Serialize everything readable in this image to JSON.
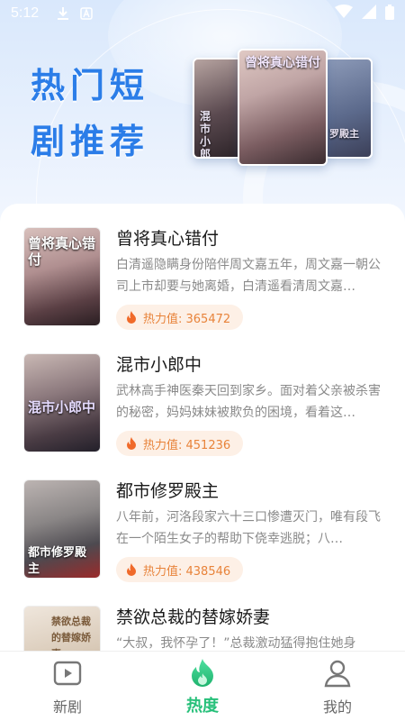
{
  "status_bar": {
    "time": "5:12",
    "left_icons": [
      "download-icon",
      "notification-a-icon"
    ],
    "right_icons": [
      "wifi-icon",
      "signal-icon",
      "battery-icon"
    ]
  },
  "hero": {
    "title_line1": "热门短",
    "title_line2": "剧推荐",
    "posters": [
      {
        "title": "混市小郎中"
      },
      {
        "title": "曾将真心错付"
      },
      {
        "title": "罗殿主"
      }
    ]
  },
  "dramas": [
    {
      "title": "曾将真心错付",
      "cover_text": "曾将真心错付",
      "description": "白清遥隐瞒身份陪伴周文嘉五年，周文嘉一朝公司上市却要与她离婚，白清遥看清周文嘉…",
      "heat_label": "热力值: 365472"
    },
    {
      "title": "混市小郎中",
      "cover_text": "混市小郎中",
      "description": "武林高手神医秦天回到家乡。面对着父亲被杀害的秘密，妈妈妹妹被欺负的困境，看着这…",
      "heat_label": "热力值: 451236"
    },
    {
      "title": "都市修罗殿主",
      "cover_text": "都市修罗殿主",
      "description": "八年前，河洛段家六十三口惨遭灭门，唯有段飞在一个陌生女子的帮助下侥幸逃脱；八…",
      "heat_label": "热力值: 438546"
    },
    {
      "title": "禁欲总裁的替嫁娇妻",
      "cover_text": "禁欲总裁的替嫁娇妻",
      "description": "“大叔，我怀孕了！”总裁激动猛得抱住她身",
      "heat_label": ""
    }
  ],
  "tabs": [
    {
      "label": "新剧",
      "icon": "play-video-icon",
      "active": false
    },
    {
      "label": "热度",
      "icon": "flame-icon",
      "active": true
    },
    {
      "label": "我的",
      "icon": "user-icon",
      "active": false
    }
  ],
  "colors": {
    "accent_green": "#27c07a",
    "title_blue": "#2b7de8",
    "heat_orange": "#e8833a",
    "heat_bg": "#fdf0e6"
  }
}
